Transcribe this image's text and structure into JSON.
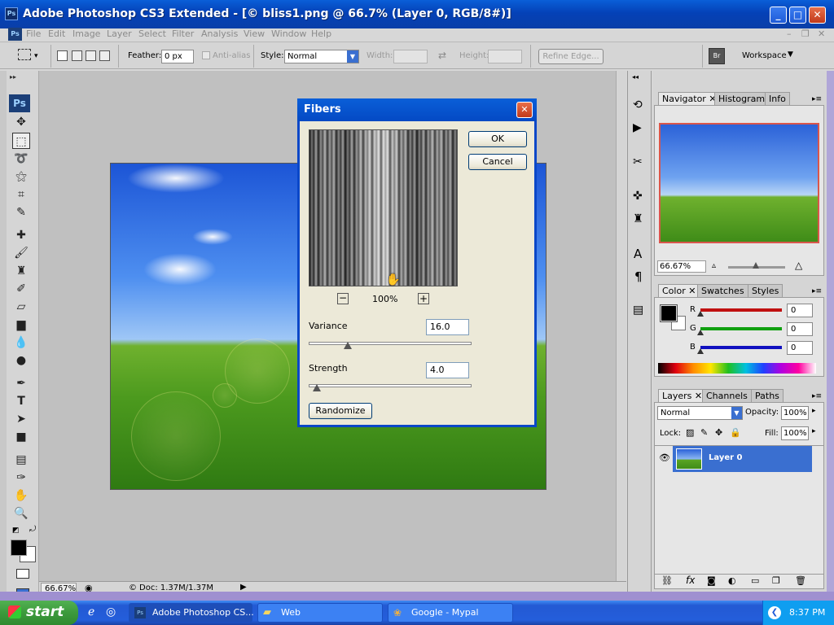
{
  "window": {
    "title": "Adobe Photoshop CS3 Extended - [© bliss1.png @ 66.7% (Layer 0, RGB/8#)]",
    "app_badge": "Ps"
  },
  "menu": [
    "File",
    "Edit",
    "Image",
    "Layer",
    "Select",
    "Filter",
    "Analysis",
    "View",
    "Window",
    "Help"
  ],
  "options": {
    "feather_label": "Feather:",
    "feather_value": "0 px",
    "antialias_label": "Anti-alias",
    "style_label": "Style:",
    "style_value": "Normal",
    "width_label": "Width:",
    "height_label": "Height:",
    "refine_edge": "Refine Edge...",
    "workspace": "Workspace"
  },
  "tools_badge": "Ps",
  "status": {
    "zoom": "66.67%",
    "doc": "Doc: 1.37M/1.37M"
  },
  "dialog": {
    "title": "Fibers",
    "ok": "OK",
    "cancel": "Cancel",
    "zoom": "100%",
    "variance_label": "Variance",
    "variance_value": "16.0",
    "variance_level": 16,
    "strength_label": "Strength",
    "strength_value": "4.0",
    "strength_level": 4,
    "randomize": "Randomize"
  },
  "navigator": {
    "tabs": [
      "Navigator",
      "Histogram",
      "Info"
    ],
    "zoom": "66.67%"
  },
  "color": {
    "tabs": [
      "Color",
      "Swatches",
      "Styles"
    ],
    "channels": [
      {
        "name": "R",
        "value": "0",
        "color": "#c01010"
      },
      {
        "name": "G",
        "value": "0",
        "color": "#10a010"
      },
      {
        "name": "B",
        "value": "0",
        "color": "#1010c0"
      }
    ]
  },
  "layers": {
    "tabs": [
      "Layers",
      "Channels",
      "Paths"
    ],
    "blend_mode": "Normal",
    "opacity_label": "Opacity:",
    "opacity_value": "100%",
    "lock_label": "Lock:",
    "fill_label": "Fill:",
    "fill_value": "100%",
    "items": [
      {
        "name": "Layer 0"
      }
    ]
  },
  "taskbar": {
    "start": "start",
    "tasks": [
      "Adobe Photoshop CS...",
      "Web",
      "Google - Mypal"
    ],
    "clock": "8:37 PM"
  }
}
